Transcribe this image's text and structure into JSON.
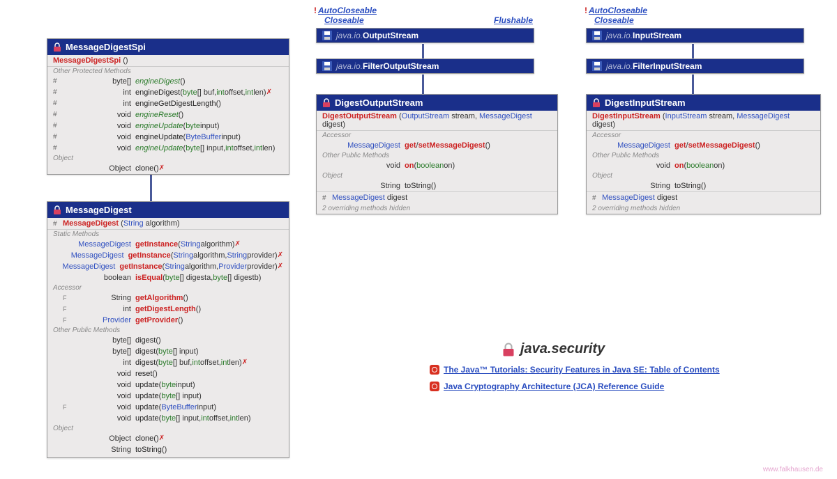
{
  "package": {
    "name": "java.security"
  },
  "credit": "www.falkhausen.de",
  "refs": {
    "r1": "The Java™ Tutorials: Security Features in Java SE: Table of Contents",
    "r2": "Java Cryptography Architecture (JCA) Reference Guide"
  },
  "ifaces": {
    "autocloseable": "AutoCloseable",
    "closeable": "Closeable",
    "flushable": "Flushable"
  },
  "streams": {
    "out1_prefix": "java.io.",
    "out1": "OutputStream",
    "out2_prefix": "java.io.",
    "out2": "FilterOutputStream",
    "in1_prefix": "java.io.",
    "in1": "InputStream",
    "in2_prefix": "java.io.",
    "in2": "FilterInputStream"
  },
  "mdSpi": {
    "title": "MessageDigestSpi",
    "ctor": "MessageDigestSpi",
    "sec1": "Other Protected Methods",
    "m1_mod": "#",
    "m1_rt": "byte[]",
    "m1_n": "engineDigest",
    "m1_p": " ()",
    "m2_mod": "#",
    "m2_rt": "int",
    "m2_n": "engineDigest",
    "m2_p": " (byte[] buf, int offset, int len)",
    "m3_mod": "#",
    "m3_rt": "int",
    "m3_n": "engineGetDigestLength",
    "m3_p": " ()",
    "m4_mod": "#",
    "m4_rt": "void",
    "m4_n": "engineReset",
    "m4_p": " ()",
    "m5_mod": "#",
    "m5_rt": "void",
    "m5_n": "engineUpdate",
    "m5_p": " (byte input)",
    "m6_mod": "#",
    "m6_rt": "void",
    "m6_n": "engineUpdate",
    "m6_p": " (ByteBuffer input)",
    "m7_mod": "#",
    "m7_rt": "void",
    "m7_n": "engineUpdate",
    "m7_p": " (byte[] input, int offset, int len)",
    "sec2": "Object",
    "m8_rt": "Object",
    "m8_n": "clone",
    "m8_p": " ()"
  },
  "md": {
    "title": "MessageDigest",
    "ctor_mod": "#",
    "ctor": "MessageDigest",
    "ctor_p": " (String algorithm)",
    "sec1": "Static Methods",
    "s1_rt": "MessageDigest",
    "s1_n": "getInstance",
    "s1_p": " (String algorithm)",
    "s2_rt": "MessageDigest",
    "s2_n": "getInstance",
    "s2_p": " (String algorithm, String provider)",
    "s3_rt": "MessageDigest",
    "s3_n": "getInstance",
    "s3_p": " (String algorithm, Provider provider)",
    "s4_rt": "boolean",
    "s4_n": "isEqual",
    "s4_p": " (byte[] digesta, byte[] digestb)",
    "sec2": "Accessor",
    "a1_rt": "String",
    "a1_n": "getAlgorithm",
    "a1_p": " ()",
    "a2_rt": "int",
    "a2_n": "getDigestLength",
    "a2_p": " ()",
    "a3_rt": "Provider",
    "a3_n": "getProvider",
    "a3_p": " ()",
    "sec3": "Other Public Methods",
    "p1_rt": "byte[]",
    "p1_n": "digest",
    "p1_p": " ()",
    "p2_rt": "byte[]",
    "p2_n": "digest",
    "p2_p": " (byte[] input)",
    "p3_rt": "int",
    "p3_n": "digest",
    "p3_p": " (byte[] buf, int offset, int len)",
    "p4_rt": "void",
    "p4_n": "reset",
    "p4_p": " ()",
    "p5_rt": "void",
    "p5_n": "update",
    "p5_p": " (byte input)",
    "p6_rt": "void",
    "p6_n": "update",
    "p6_p": " (byte[] input)",
    "p7_rt": "void",
    "p7_n": "update",
    "p7_p": " (ByteBuffer input)",
    "p8_rt": "void",
    "p8_n": "update",
    "p8_p": " (byte[] input, int offset, int len)",
    "sec4": "Object",
    "o1_rt": "Object",
    "o1_n": "clone",
    "o1_p": " ()",
    "o2_rt": "String",
    "o2_n": "toString",
    "o2_p": " ()"
  },
  "dos": {
    "title": "DigestOutputStream",
    "ctor": "DigestOutputStream",
    "ctor_p": " (OutputStream stream, MessageDigest digest)",
    "sec1": "Accessor",
    "a1_rt": "MessageDigest",
    "a1_n": "get",
    "a1_sep": "/",
    "a1_n2": "setMessageDigest",
    "a1_p": " ()",
    "sec2": "Other Public Methods",
    "p1_rt": "void",
    "p1_n": "on",
    "p1_p": " (boolean on)",
    "sec3": "Object",
    "o1_rt": "String",
    "o1_n": "toString",
    "o1_p": " ()",
    "f_mod": "#",
    "f_type": "MessageDigest",
    "f_name": " digest",
    "hidden": "2 overriding methods hidden"
  },
  "dis": {
    "title": "DigestInputStream",
    "ctor": "DigestInputStream",
    "ctor_p": " (InputStream stream, MessageDigest digest)",
    "sec1": "Accessor",
    "a1_rt": "MessageDigest",
    "a1_n": "get",
    "a1_sep": "/",
    "a1_n2": "setMessageDigest",
    "a1_p": " ()",
    "sec2": "Other Public Methods",
    "p1_rt": "void",
    "p1_n": "on",
    "p1_p": " (boolean on)",
    "sec3": "Object",
    "o1_rt": "String",
    "o1_n": "toString",
    "o1_p": " ()",
    "f_mod": "#",
    "f_type": "MessageDigest",
    "f_name": " digest",
    "hidden": "2 overriding methods hidden"
  }
}
